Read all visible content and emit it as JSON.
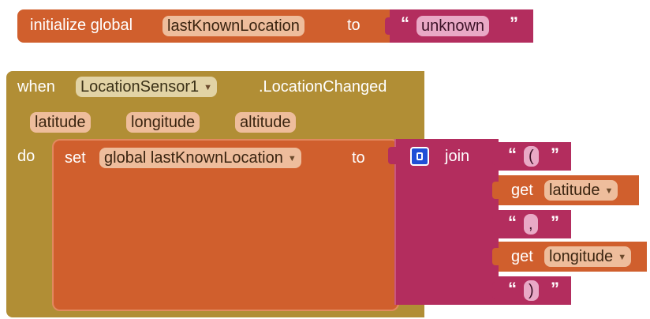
{
  "init_block": {
    "keyword": "initialize global",
    "variable": "lastKnownLocation",
    "to_label": "to",
    "value_text": "unknown"
  },
  "event_block": {
    "when_label": "when",
    "component": "LocationSensor1",
    "event_name": ".LocationChanged",
    "params": [
      "latitude",
      "longitude",
      "altitude"
    ],
    "do_label": "do"
  },
  "set_block": {
    "set_label": "set",
    "variable": "global lastKnownLocation",
    "to_label": "to"
  },
  "join_block": {
    "label": "join",
    "items": [
      {
        "kind": "text",
        "value": "("
      },
      {
        "kind": "get",
        "get_label": "get",
        "variable": "latitude"
      },
      {
        "kind": "text",
        "value": ","
      },
      {
        "kind": "get",
        "get_label": "get",
        "variable": "longitude"
      },
      {
        "kind": "text",
        "value": ")"
      }
    ]
  },
  "colors": {
    "variables": "#d05f2d",
    "text": "#b32d5e",
    "event": "#b18e35",
    "white": "#ffffff"
  },
  "icons": {
    "mutator": "mutator-gear-icon",
    "dropdown": "dropdown-arrow-icon"
  }
}
